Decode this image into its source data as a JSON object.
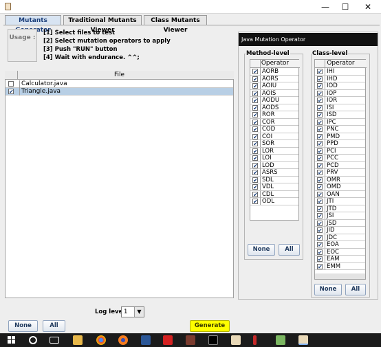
{
  "window": {
    "minimize": "—",
    "maximize": "☐",
    "close": "✕"
  },
  "tabs": [
    "Mutants Generator",
    "Traditional Mutants Viewer",
    "Class Mutants Viewer"
  ],
  "usage": {
    "label": "Usage :",
    "steps": [
      "[1] Select files to test",
      "[2] Select mutation operators to apply",
      "[3] Push \"RUN\" button",
      "[4] Wait with endurance. ^^;"
    ]
  },
  "files": {
    "header": "File",
    "rows": [
      {
        "name": "Calculator.java",
        "checked": false
      },
      {
        "name": "Triangle.java",
        "checked": true
      }
    ]
  },
  "log": {
    "label": "Log level",
    "value": "1"
  },
  "buttons": {
    "none": "None",
    "all": "All",
    "generate": "Generate"
  },
  "operator_panel": {
    "title": "Java Mutation Operator",
    "method_label": "Method-level",
    "class_label": "Class-level",
    "column_header": "Operator",
    "method_ops": [
      "AORB",
      "AORS",
      "AOIU",
      "AOIS",
      "AODU",
      "AODS",
      "ROR",
      "COR",
      "COD",
      "COI",
      "SOR",
      "LOR",
      "LOI",
      "LOD",
      "ASRS",
      "SDL",
      "VDL",
      "CDL",
      "ODL"
    ],
    "class_ops": [
      "IHI",
      "IHD",
      "IOD",
      "IOP",
      "IOR",
      "ISI",
      "ISD",
      "IPC",
      "PNC",
      "PMD",
      "PPD",
      "PCI",
      "PCC",
      "PCD",
      "PRV",
      "OMR",
      "OMD",
      "OAN",
      "JTI",
      "JTD",
      "JSI",
      "JSD",
      "JID",
      "JDC",
      "EOA",
      "EOC",
      "EAM",
      "EMM"
    ]
  },
  "icons": {
    "app": "java-cup-icon",
    "taskbar": [
      "windows-start-icon",
      "search-circle-icon",
      "task-view-icon",
      "file-explorer-icon",
      "chrome-icon",
      "firefox-icon",
      "word-icon",
      "pdf-icon",
      "settings-icon",
      "terminal-icon",
      "java-icon",
      "brush-icon",
      "java-icon",
      "java-icon"
    ]
  }
}
